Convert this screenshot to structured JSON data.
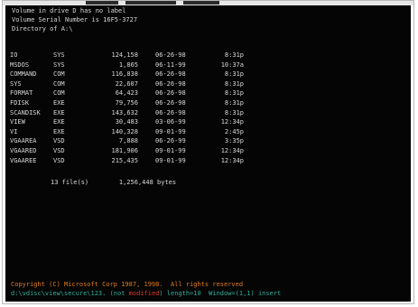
{
  "header": {
    "line1": "Volume in drive D has no label",
    "line2": "Volume Serial Number is 16F5-3727",
    "line3": "Directory of A:\\"
  },
  "files": [
    {
      "name": "IO",
      "ext": "SYS",
      "size": "124,158",
      "date": "06-26-98",
      "time": "8:31p"
    },
    {
      "name": "MSDOS",
      "ext": "SYS",
      "size": "1,865",
      "date": "06-11-99",
      "time": "10:37a"
    },
    {
      "name": "COMMAND",
      "ext": "COM",
      "size": "116,838",
      "date": "06-26-98",
      "time": "8:31p"
    },
    {
      "name": "SYS",
      "ext": "COM",
      "size": "22,607",
      "date": "06-26-98",
      "time": "8:31p"
    },
    {
      "name": "FORMAT",
      "ext": "COM",
      "size": "64,423",
      "date": "06-26-98",
      "time": "8:31p"
    },
    {
      "name": "FDISK",
      "ext": "EXE",
      "size": "79,756",
      "date": "06-26-98",
      "time": "8:31p"
    },
    {
      "name": "SCANDISK",
      "ext": "EXE",
      "size": "143,632",
      "date": "06-26-98",
      "time": "8:31p"
    },
    {
      "name": "VIEW",
      "ext": "EXE",
      "size": "30,483",
      "date": "03-06-99",
      "time": "12:34p"
    },
    {
      "name": "VI",
      "ext": "EXE",
      "size": "140,328",
      "date": "09-01-99",
      "time": "2:45p"
    },
    {
      "name": "VGAAREA",
      "ext": "VSD",
      "size": "7,888",
      "date": "06-26-99",
      "time": "3:35p"
    },
    {
      "name": "VGAARED",
      "ext": "VSD",
      "size": "181,906",
      "date": "09-01-99",
      "time": "12:34p"
    },
    {
      "name": "VGAAREE",
      "ext": "VSD",
      "size": "215,435",
      "date": "09-01-99",
      "time": "12:34p"
    }
  ],
  "summary": {
    "count": "13 file(s)",
    "bytes": "1,256,448 bytes"
  },
  "footer": {
    "copyright": "Copyright (C) Microsoft Corp 1987, 1998.  All rights reserved",
    "path": "d:\\vdisc\\view\\secure\\123.",
    "pre_warn": " (not ",
    "warn": "modified",
    "post_warn": ") length=10  Window=(1,1) insert"
  },
  "colors": {
    "screen_bg": "#050505",
    "text": "#d8d8d8",
    "copyright": "#e07a1a",
    "status": "#2fae9a",
    "warn": "#d43a2a"
  }
}
